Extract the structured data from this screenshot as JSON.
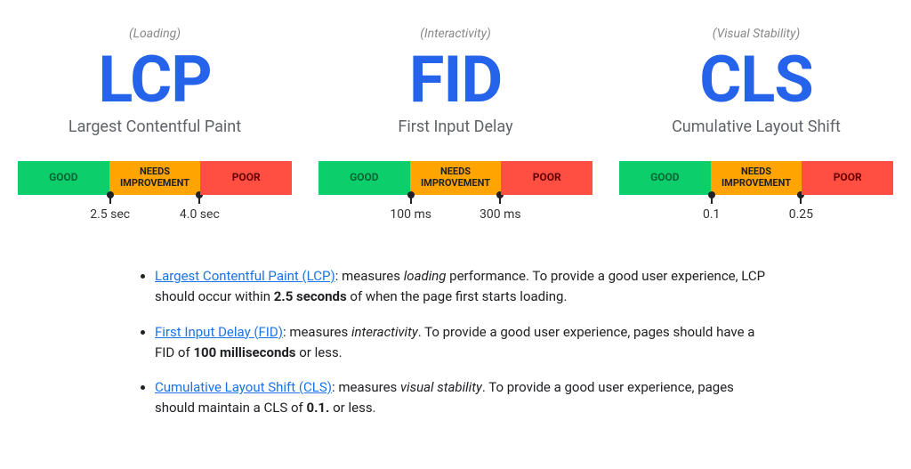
{
  "labels": {
    "good": "GOOD",
    "needs_line1": "NEEDS",
    "needs_line2": "IMPROVEMENT",
    "poor": "POOR"
  },
  "metrics": [
    {
      "category": "(Loading)",
      "acronym": "LCP",
      "fullname": "Largest Contentful Paint",
      "threshold_low": "2.5 sec",
      "threshold_high": "4.0 sec"
    },
    {
      "category": "(Interactivity)",
      "acronym": "FID",
      "fullname": "First Input Delay",
      "threshold_low": "100 ms",
      "threshold_high": "300 ms"
    },
    {
      "category": "(Visual Stability)",
      "acronym": "CLS",
      "fullname": "Cumulative Layout Shift",
      "threshold_low": "0.1",
      "threshold_high": "0.25"
    }
  ],
  "desc": [
    {
      "link": "Largest Contentful Paint (LCP)",
      "before_italic": ": measures ",
      "italic": "loading",
      "after_italic": " performance. To provide a good user experience, LCP should occur within ",
      "bold": "2.5 seconds",
      "after_bold": " of when the page first starts loading."
    },
    {
      "link": "First Input Delay (FID)",
      "before_italic": ": measures ",
      "italic": "interactivity",
      "after_italic": ". To provide a good user experience, pages should have a FID of ",
      "bold": "100 milliseconds",
      "after_bold": " or less."
    },
    {
      "link": "Cumulative Layout Shift (CLS)",
      "before_italic": ": measures ",
      "italic": "visual stability",
      "after_italic": ". To provide a good user experience, pages should maintain a CLS of ",
      "bold": "0.1.",
      "after_bold": " or less."
    }
  ]
}
